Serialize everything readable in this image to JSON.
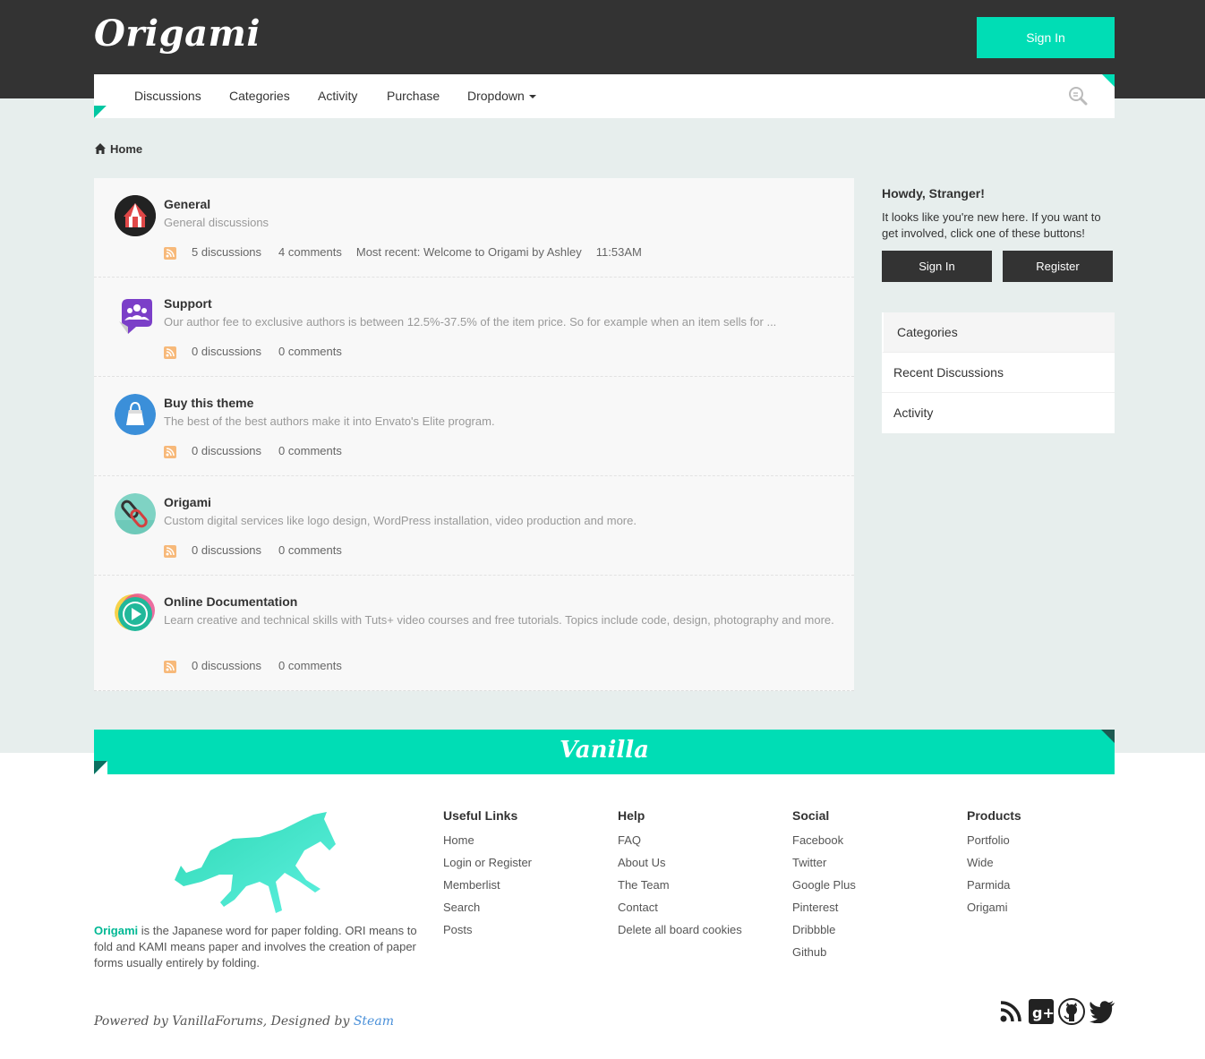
{
  "header": {
    "logo": "Origami",
    "sign_in": "Sign In"
  },
  "nav": {
    "items": [
      "Discussions",
      "Categories",
      "Activity",
      "Purchase",
      "Dropdown"
    ]
  },
  "breadcrumb": {
    "home": "Home"
  },
  "categories": [
    {
      "title": "General",
      "description": "General discussions",
      "discussions": "5 discussions",
      "comments": "4 comments",
      "most_recent": "Most recent: Welcome to Origami by Ashley",
      "time": "11:53AM",
      "icon": "circus-tent-icon"
    },
    {
      "title": "Support",
      "description": "Our author fee to exclusive authors is between 12.5%-37.5% of the item price. So for example when an item sells for ...",
      "discussions": "0 discussions",
      "comments": "0 comments",
      "icon": "support-users-icon"
    },
    {
      "title": "Buy this theme",
      "description": "The best of the best authors make it into Envato's Elite program.",
      "discussions": "0 discussions",
      "comments": "0 comments",
      "icon": "shopping-bag-icon"
    },
    {
      "title": "Origami",
      "description": "Custom digital services like logo design, WordPress installation, video production and more.",
      "discussions": "0 discussions",
      "comments": "0 comments",
      "icon": "link-chain-icon"
    },
    {
      "title": "Online Documentation",
      "description": "Learn creative and technical skills with Tuts+ video courses and free tutorials. Topics include code, design, photography and more.",
      "discussions": "0 discussions",
      "comments": "0 comments",
      "icon": "play-video-icon"
    }
  ],
  "sidebar": {
    "howdy_title": "Howdy, Stranger!",
    "howdy_text": "It looks like you're new here. If you want to get involved, click one of these buttons!",
    "sign_in": "Sign In",
    "register": "Register",
    "panel": [
      "Categories",
      "Recent Discussions",
      "Activity"
    ]
  },
  "footer": {
    "vanilla_logo": "Vanilla",
    "about_brand": "Origami",
    "about_text": " is the Japanese word for paper folding. ORI means to fold and KAMI means paper and involves the creation of paper forms usually entirely by folding.",
    "columns": [
      {
        "title": "Useful Links",
        "links": [
          "Home",
          "Login or Register",
          "Memberlist",
          "Search",
          "Posts"
        ]
      },
      {
        "title": "Help",
        "links": [
          "FAQ",
          "About Us",
          "The Team",
          "Contact",
          "Delete all board cookies"
        ]
      },
      {
        "title": "Social",
        "links": [
          "Facebook",
          "Twitter",
          "Google Plus",
          "Pinterest",
          "Dribbble",
          "Github"
        ]
      },
      {
        "title": "Products",
        "links": [
          "Portfolio",
          "Wide",
          "Parmida",
          "Origami"
        ]
      }
    ],
    "powered_prefix": "Powered by VanillaForums, Designed by ",
    "powered_steam": "Steam",
    "social_icons": [
      "rss-icon",
      "google-plus-icon",
      "github-icon",
      "twitter-icon"
    ]
  },
  "colors": {
    "accent": "#00ddb5",
    "dark": "#333333",
    "bg": "#e7eeed"
  }
}
